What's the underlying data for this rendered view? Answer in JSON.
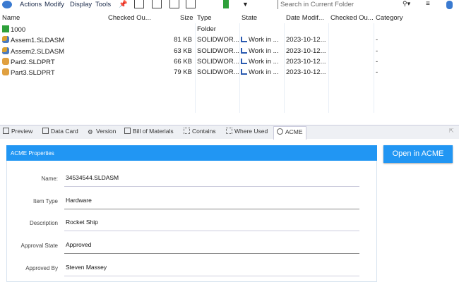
{
  "menu": [
    "Actions",
    "Modify",
    "Display",
    "Tools"
  ],
  "search": {
    "placeholder": "Search in Current Folder"
  },
  "columns": [
    "Name",
    "Checked Ou...",
    "Size",
    "Type",
    "State",
    "Date Modif...",
    "Checked Ou...",
    "Category"
  ],
  "rows": [
    {
      "icon": "folder-icon",
      "name": "1000",
      "size": "",
      "type": "Folder",
      "state": "",
      "date": "",
      "category": ""
    },
    {
      "icon": "assembly-icon",
      "name": "Assem1.SLDASM",
      "size": "81 KB",
      "type": "SOLIDWOR...",
      "state": "Work in ...",
      "date": "2023-10-12...",
      "category": "-"
    },
    {
      "icon": "assembly-icon",
      "name": "Assem2.SLDASM",
      "size": "63 KB",
      "type": "SOLIDWOR...",
      "state": "Work in ...",
      "date": "2023-10-12...",
      "category": "-"
    },
    {
      "icon": "part-icon",
      "name": "Part2.SLDPRT",
      "size": "66 KB",
      "type": "SOLIDWOR...",
      "state": "Work in ...",
      "date": "2023-10-12...",
      "category": "-"
    },
    {
      "icon": "part-icon",
      "name": "Part3.SLDPRT",
      "size": "79 KB",
      "type": "SOLIDWOR...",
      "state": "Work in ...",
      "date": "2023-10-12...",
      "category": "-"
    }
  ],
  "tabs": [
    "Preview",
    "Data Card",
    "Version",
    "Bill of Materials",
    "Contains",
    "Where Used",
    "ACME"
  ],
  "active_tab": "ACME",
  "acme": {
    "header": "ACME Properties",
    "open_button": "Open in ACME",
    "fields": [
      {
        "label": "Name:",
        "value": "34534544.SLDASM"
      },
      {
        "label": "Item Type",
        "value": "Hardware"
      },
      {
        "label": "Description",
        "value": "Rocket Ship"
      },
      {
        "label": "Approval State",
        "value": "Approved"
      },
      {
        "label": "Approved By",
        "value": "Steven Massey"
      }
    ]
  },
  "colors": {
    "accent": "#2196f3",
    "folder": "#2ea03a"
  }
}
